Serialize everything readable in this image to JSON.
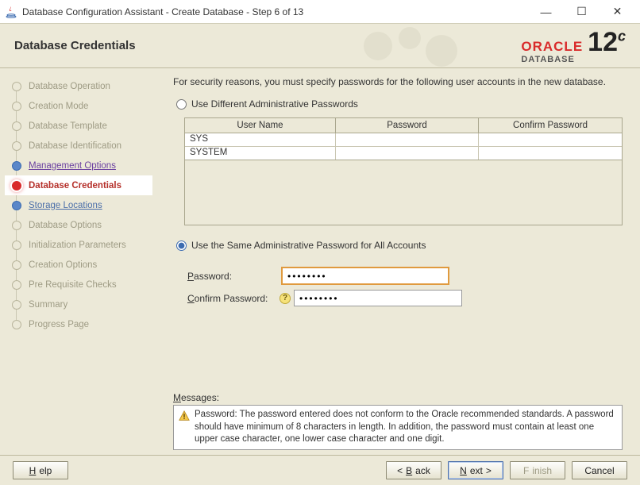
{
  "window": {
    "title": "Database Configuration Assistant - Create Database - Step 6 of 13"
  },
  "header": {
    "title": "Database Credentials",
    "logo_brand": "ORACLE",
    "logo_sub": "DATABASE",
    "logo_version": "12",
    "logo_version_suffix": "c"
  },
  "sidebar": {
    "items": [
      {
        "label": "Database Operation",
        "state": "disabled"
      },
      {
        "label": "Creation Mode",
        "state": "disabled"
      },
      {
        "label": "Database Template",
        "state": "disabled"
      },
      {
        "label": "Database Identification",
        "state": "disabled"
      },
      {
        "label": "Management Options",
        "state": "visited"
      },
      {
        "label": "Database Credentials",
        "state": "current"
      },
      {
        "label": "Storage Locations",
        "state": "upcoming"
      },
      {
        "label": "Database Options",
        "state": "disabled"
      },
      {
        "label": "Initialization Parameters",
        "state": "disabled"
      },
      {
        "label": "Creation Options",
        "state": "disabled"
      },
      {
        "label": "Pre Requisite Checks",
        "state": "disabled"
      },
      {
        "label": "Summary",
        "state": "disabled"
      },
      {
        "label": "Progress Page",
        "state": "disabled"
      }
    ]
  },
  "main": {
    "instruction": "For security reasons, you must specify passwords for the following user accounts in the new database.",
    "radio_diff": "Use Different Administrative Passwords",
    "radio_same": "Use the Same Administrative Password for All Accounts",
    "selected_option": "same",
    "table": {
      "headers": {
        "user": "User Name",
        "pw": "Password",
        "cpw": "Confirm Password"
      },
      "rows": [
        {
          "user": "SYS",
          "pw": "",
          "cpw": ""
        },
        {
          "user": "SYSTEM",
          "pw": "",
          "cpw": ""
        }
      ]
    },
    "fields": {
      "password_label": "Password:",
      "confirm_label": "Confirm Password:",
      "password_value": "••••••••",
      "confirm_value": "••••••••"
    },
    "messages_label": "Messages:",
    "messages_text": "Password: The password entered does not conform to the Oracle recommended standards. A password should have minimum of 8 characters in length. In addition, the password must contain at least one upper case character, one lower case character and one digit."
  },
  "footer": {
    "help": "Help",
    "back": "Back",
    "next": "Next",
    "finish": "Finish",
    "cancel": "Cancel"
  }
}
